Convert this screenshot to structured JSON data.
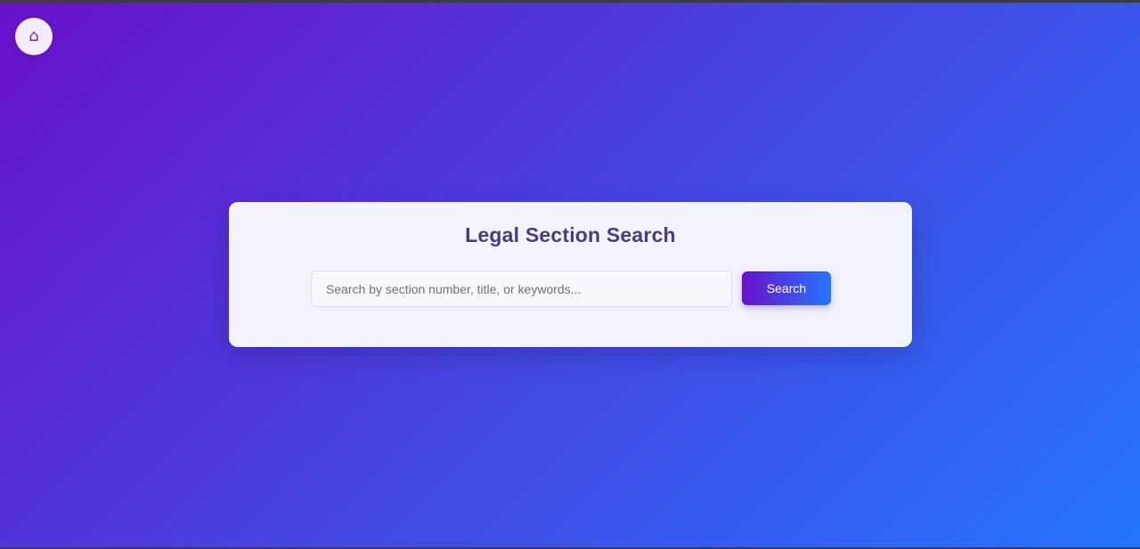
{
  "colors": {
    "gradient_start": "#6a11cb",
    "gradient_end": "#2575fc",
    "card_background": "#f3f3fb",
    "title_color": "#463d82",
    "home_button_background": "#f3ecfb"
  },
  "nav": {
    "home_icon": "⌂",
    "home_icon_name": "home-icon"
  },
  "search_card": {
    "title": "Legal Section Search",
    "input": {
      "placeholder": "Search by section number, title, or keywords...",
      "value": ""
    },
    "button_label": "Search"
  }
}
